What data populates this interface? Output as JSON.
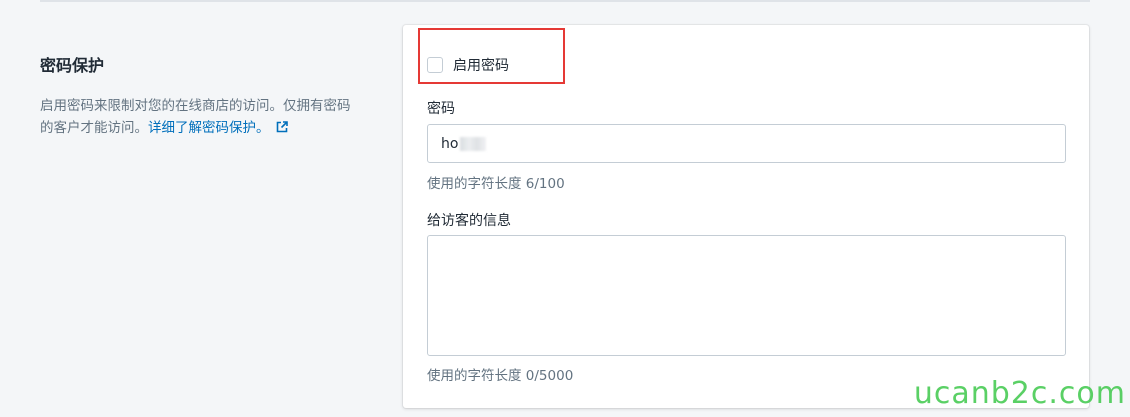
{
  "section": {
    "title": "密码保护",
    "description": "启用密码来限制对您的在线商店的访问。仅拥有密码的客户才能访问。",
    "learn_more": "详细了解密码保护。",
    "external_icon": "external-link-icon"
  },
  "card": {
    "enable_password_label": "启用密码",
    "enable_password_checked": false,
    "password_label": "密码",
    "password_value": "ho",
    "password_counter": "使用的字符长度 6/100",
    "message_label": "给访客的信息",
    "message_value": "",
    "message_counter": "使用的字符长度 0/5000"
  },
  "colors": {
    "link": "#006fbb",
    "highlight": "#e53935",
    "watermark": "#3ec84b"
  },
  "watermark": "ucanb2c.com"
}
